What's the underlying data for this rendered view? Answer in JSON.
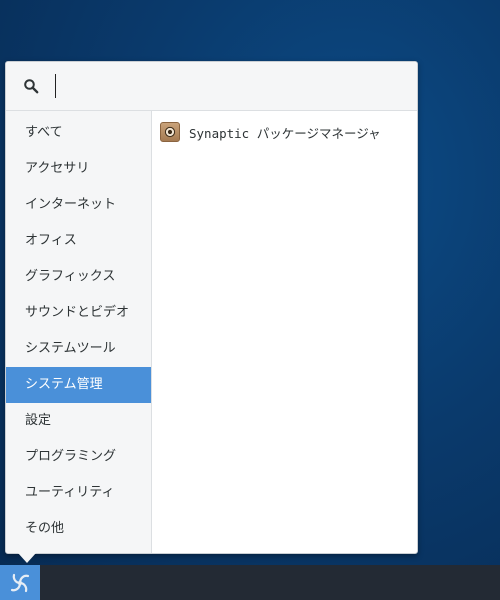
{
  "search": {
    "value": "",
    "placeholder": ""
  },
  "categories": [
    {
      "label": "すべて",
      "active": false
    },
    {
      "label": "アクセサリ",
      "active": false
    },
    {
      "label": "インターネット",
      "active": false
    },
    {
      "label": "オフィス",
      "active": false
    },
    {
      "label": "グラフィックス",
      "active": false
    },
    {
      "label": "サウンドとビデオ",
      "active": false
    },
    {
      "label": "システムツール",
      "active": false
    },
    {
      "label": "システム管理",
      "active": true
    },
    {
      "label": "設定",
      "active": false
    },
    {
      "label": "プログラミング",
      "active": false
    },
    {
      "label": "ユーティリティ",
      "active": false
    },
    {
      "label": "その他",
      "active": false
    }
  ],
  "apps": [
    {
      "label": "Synaptic パッケージマネージャ",
      "icon": "package-icon"
    }
  ],
  "panel": {
    "launcher_icon": "spiral-logo-icon"
  },
  "colors": {
    "accent": "#4a90d9",
    "panel": "#232a34",
    "sidebar": "#f5f6f7"
  }
}
